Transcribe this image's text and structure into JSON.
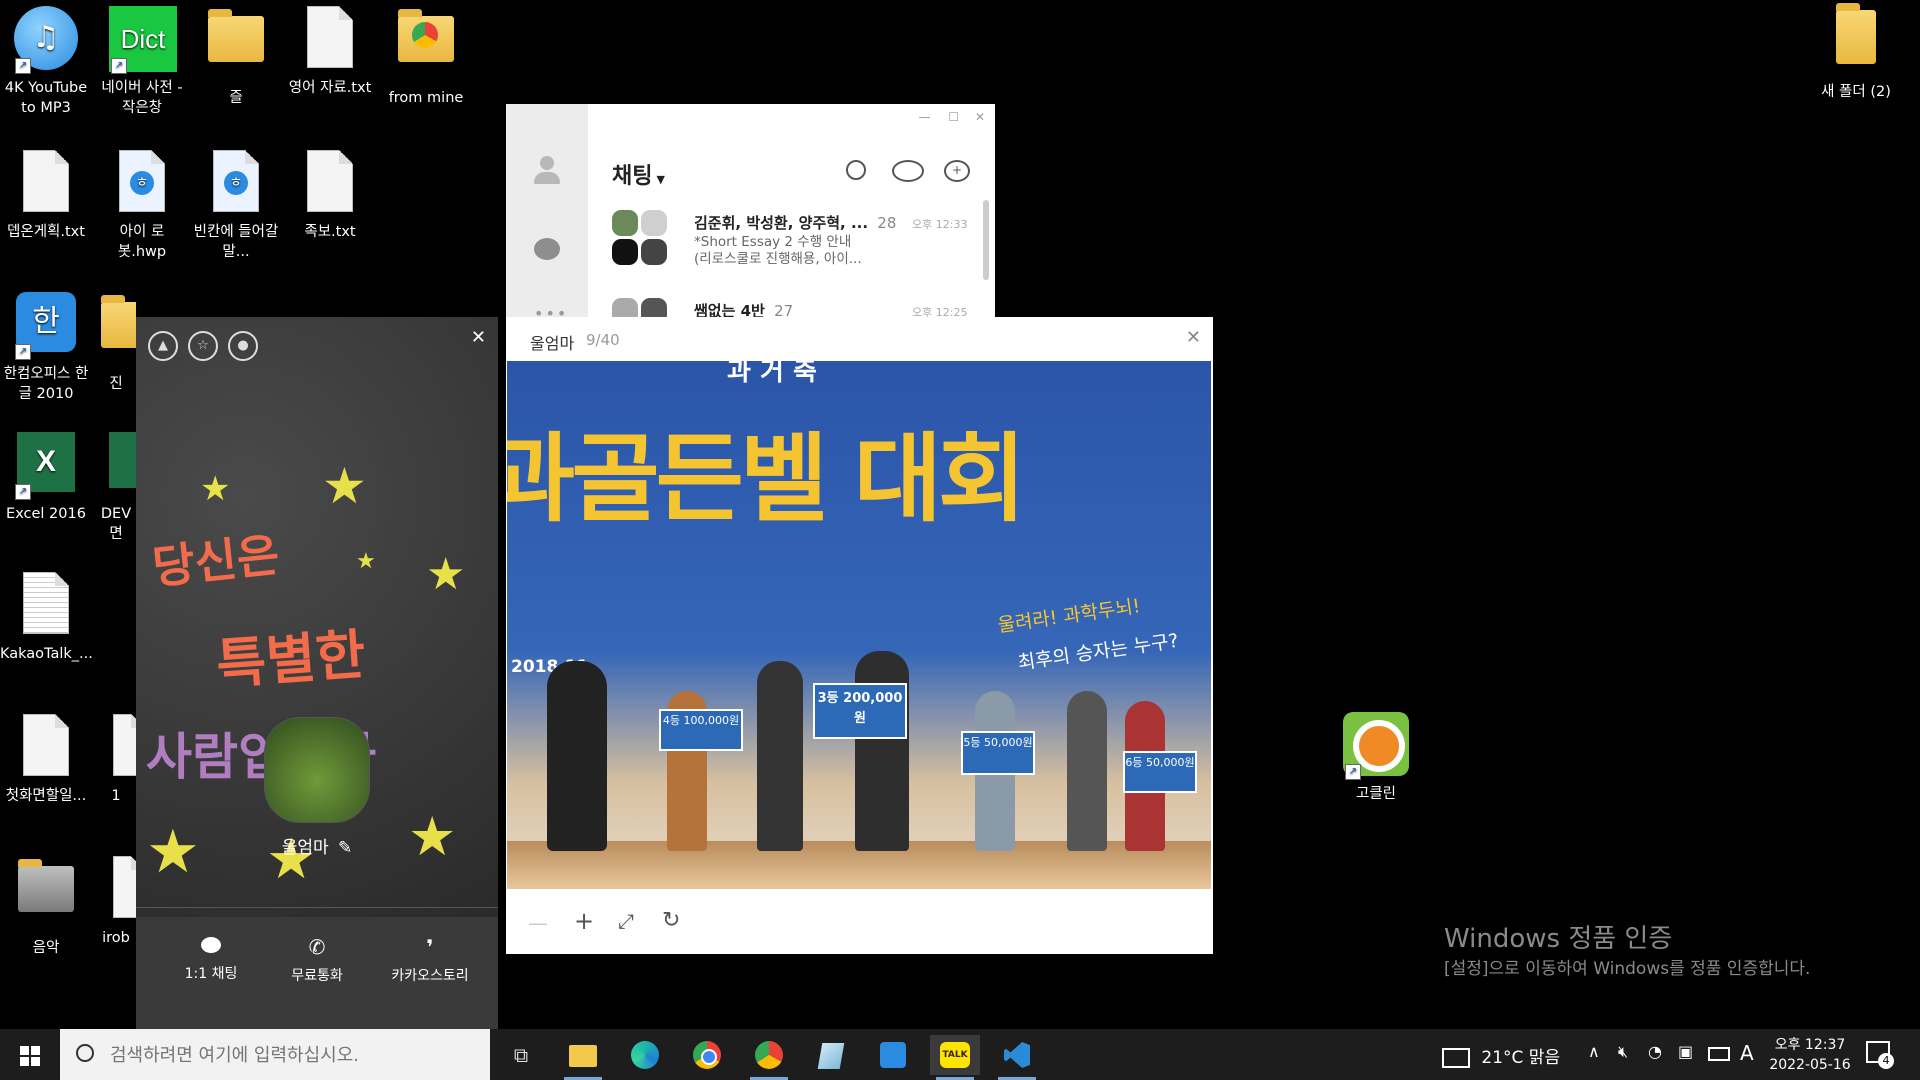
{
  "desktop": {
    "icons": [
      {
        "label": "4K YouTube to MP3"
      },
      {
        "label": "네이버 사전 - 작은창"
      },
      {
        "label": "즐"
      },
      {
        "label": "영어 자료.txt"
      },
      {
        "label": "from mine"
      },
      {
        "label": "뎁온게획.txt"
      },
      {
        "label": "아이 로봇.hwp"
      },
      {
        "label": "빈칸에 들어갈 말..."
      },
      {
        "label": "족보.txt"
      },
      {
        "label": "한컴오피스 한글 2010"
      },
      {
        "label": "진"
      },
      {
        "label": "Excel 2016"
      },
      {
        "label": "DEV 면"
      },
      {
        "label": "KakaoTalk_..."
      },
      {
        "label": "첫화면할일..."
      },
      {
        "label": "1"
      },
      {
        "label": "음악"
      },
      {
        "label": "irob"
      },
      {
        "label": "새 폴더 (2)"
      },
      {
        "label": "고클린"
      }
    ],
    "dict_logo_text": "Dict",
    "hancom_logo_text": "한",
    "excel_logo_text": "X",
    "watermark": {
      "title": "Windows 정품 인증",
      "subtitle": "[설정]으로 이동하여 Windows를 정품 인증합니다."
    }
  },
  "chat_list": {
    "title": "채팅",
    "window_controls": {
      "minimize": "—",
      "maximize": "☐",
      "close": "✕"
    },
    "items": [
      {
        "name": "김준휘, 박성환, 양주혁, ...",
        "count": "28",
        "time": "오후 12:33",
        "preview_line1": "*Short Essay 2 수행 안내",
        "preview_line2": "(리로스쿨로 진행해용, 아이..."
      },
      {
        "name": "쌤없는 4반",
        "count": "27",
        "time": "오후 12:25"
      }
    ]
  },
  "profile": {
    "name": "울엄마",
    "edit_icon": "✎",
    "close": "✕",
    "cover_text_line1": "당신은",
    "cover_text_line2": "특별한",
    "cover_text_line3": "사람입니다",
    "actions": [
      {
        "label": "1:1 채팅"
      },
      {
        "label": "무료통화"
      },
      {
        "label": "카카오스토리"
      }
    ]
  },
  "viewer": {
    "title": "울엄마",
    "counter": "9/40",
    "close": "✕",
    "photo_text": {
      "banner": "과골든벨 대회",
      "top": "과 거 축",
      "date": "2018.11.",
      "slogan1": "울려라! 과학두뇌!",
      "slogan2": "최후의 승자는 누구?",
      "prize_main": "3등 200,000원",
      "prize_4": "4등 100,000원",
      "prize_5": "5등 50,000원",
      "prize_6": "6등 50,000원"
    },
    "tools": {
      "zoom_out": "—",
      "zoom_in": "+",
      "fit": "⤢",
      "rotate": "↻"
    }
  },
  "taskbar": {
    "search_placeholder": "검색하려면 여기에 입력하십시오.",
    "weather": "21°C 맑음",
    "time": "오후 12:37",
    "date": "2022-05-16",
    "lang": "A",
    "notif_count": "4",
    "kakao_label": "TALK"
  }
}
